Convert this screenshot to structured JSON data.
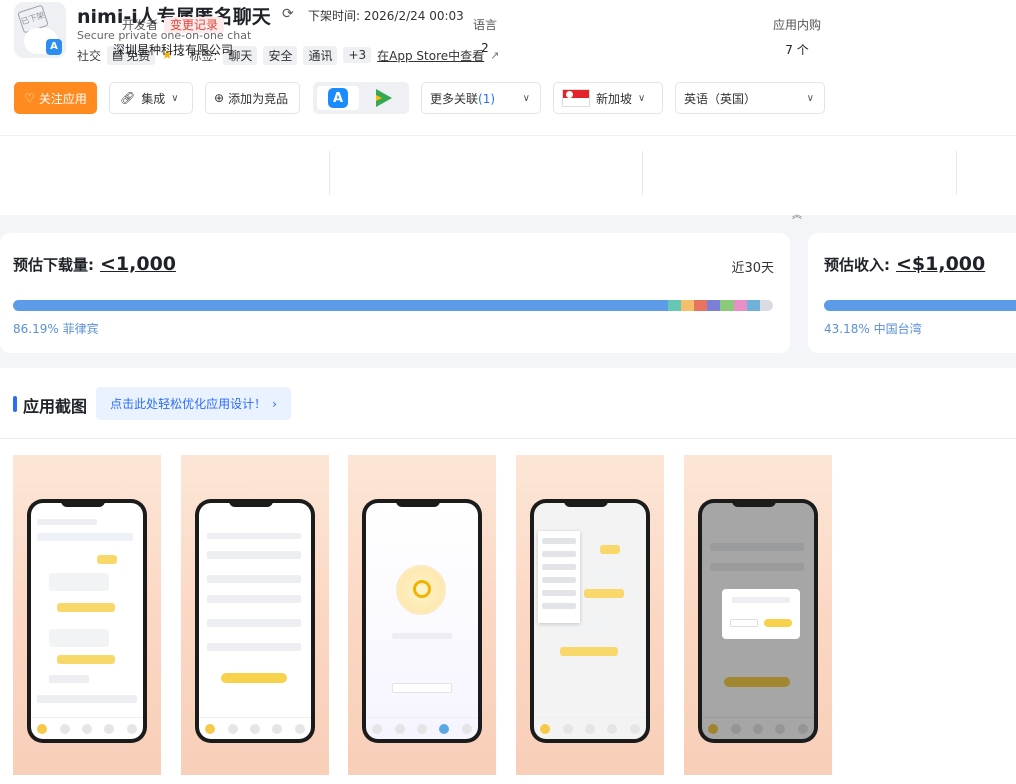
{
  "app": {
    "icon_stamp": "已下架",
    "title": "nimi-i人专属匿名聊天",
    "delist_label": "下架时间: 2026/2/24 00:03",
    "subtitle": "Secure private one-on-one chat",
    "category": "社交",
    "price": "免费",
    "rating": "-",
    "tags_label": "标签:",
    "tags": [
      "聊天",
      "安全",
      "通讯",
      "+3"
    ],
    "store_link": "在App Store中查看"
  },
  "toolbar": {
    "follow": "关注应用",
    "integrate": "集成",
    "add_competitor": "添加为竞品",
    "more_related": "更多关联",
    "more_count": "(1)",
    "country": "新加坡",
    "language": "英语（英国）"
  },
  "info": {
    "developer_label": "开发者",
    "change_log": "变更记录",
    "developer": "深圳星种科技有限公司",
    "language_label": "语言",
    "language_count": "2",
    "iap_label": "应用内购",
    "iap_count": "7 个"
  },
  "downloads": {
    "label": "预估下载量:",
    "value": "<1,000",
    "range": "近30天",
    "note": "86.19% 菲律宾",
    "share": 0.8619
  },
  "revenue": {
    "label": "预估收入:",
    "value": "<$1,000",
    "note": "43.18% 中国台湾",
    "share": 0.4318
  },
  "colors": {
    "primary": "#5b9be8",
    "accent": "#ff8a1f",
    "segments": [
      "#66c7b2",
      "#f5be6b",
      "#e8735f",
      "#7b7fd6",
      "#8cc97a",
      "#e890c5",
      "#6fb1d9",
      "#d9dce1"
    ]
  },
  "screenshots": {
    "title": "应用截图",
    "optimize_link": "点击此处轻松优化应用设计！",
    "chevron": "›"
  },
  "icons": {
    "refresh": "refresh-icon",
    "heart": "heart-icon",
    "link": "link-icon",
    "plus": "plus-circle-icon",
    "external": "external-link-icon"
  }
}
